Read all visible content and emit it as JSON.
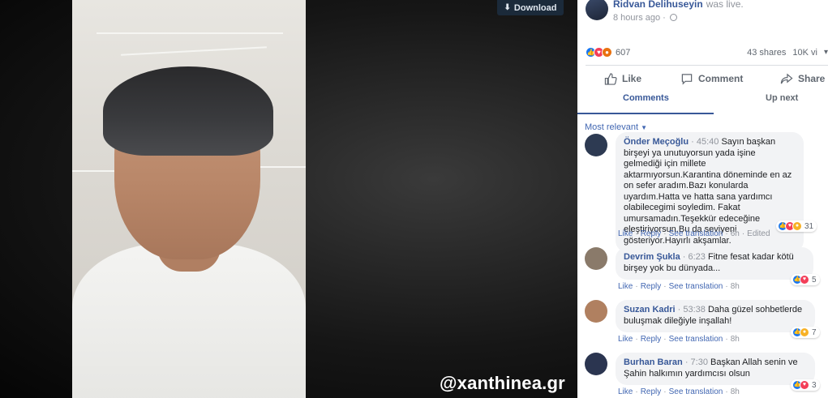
{
  "video": {
    "download_label": "Download",
    "watermark": "@xanthinea.gr"
  },
  "post": {
    "author": "Ridvan Delihuseyin",
    "status": "was live.",
    "time": "8 hours ago",
    "reaction_count": "607",
    "shares": "43 shares",
    "views": "10K vi"
  },
  "actions": {
    "like": "Like",
    "comment": "Comment",
    "share": "Share"
  },
  "tabs": {
    "comments": "Comments",
    "up_next": "Up next"
  },
  "sort": {
    "label": "Most relevant"
  },
  "comments": [
    {
      "name": "Önder Meçoğlu",
      "time": "45:40",
      "text": "Sayın başkan birşeyi ya unutuyorsun yada işine gelmediği için millete aktarmıyorsun.Karantina döneminde en az on sefer aradım.Bazı konularda uyardım.Hatta ve hatta sana yardımcı olabilecegimi soyledim. Fakat umursamadın.Teşekkür edeceğine eleştiriyorsun.Bu da seviyeni gösteriyor.Hayırlı akşamlar.",
      "like": "Like",
      "reply": "Reply",
      "translate": "See translation",
      "ago": "6h",
      "edited": "Edited",
      "reactions": "31",
      "avatar_color": "#2d3a52"
    },
    {
      "name": "Devrim Şukla",
      "time": "6:23",
      "text": "Fitne fesat kadar kötü birşey yok bu dünyada...",
      "like": "Like",
      "reply": "Reply",
      "translate": "See translation",
      "ago": "8h",
      "reactions": "5",
      "avatar_color": "#8a7a6a"
    },
    {
      "name": "Suzan Kadri",
      "time": "53:38",
      "text": "Daha güzel sohbetlerde buluşmak dileğiyle inşallah!",
      "like": "Like",
      "reply": "Reply",
      "translate": "See translation",
      "ago": "8h",
      "reactions": "7",
      "avatar_color": "#b08060"
    },
    {
      "name": "Burhan Baran",
      "time": "7:30",
      "text": "Başkan Allah senin ve Şahin halkımın yardımcısı olsun",
      "like": "Like",
      "reply": "Reply",
      "translate": "See translation",
      "ago": "8h",
      "reactions": "3",
      "avatar_color": "#2b3550"
    }
  ]
}
